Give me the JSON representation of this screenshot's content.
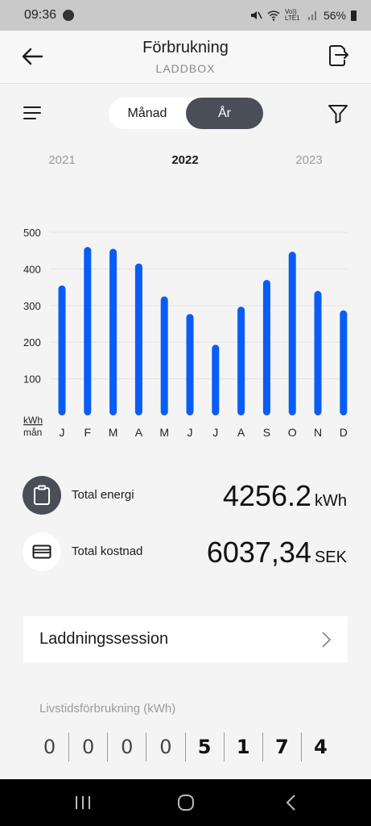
{
  "status_bar": {
    "time": "09:36",
    "battery": "56%",
    "network": "Vo)) LTE1"
  },
  "header": {
    "title": "Förbrukning",
    "subtitle": "LADDBOX"
  },
  "period_toggle": {
    "options": [
      "Månad",
      "År"
    ],
    "selected": "År"
  },
  "years": {
    "previous": "2021",
    "current": "2022",
    "next": "2023"
  },
  "chart_data": {
    "type": "bar",
    "categories": [
      "J",
      "F",
      "M",
      "A",
      "M",
      "J",
      "J",
      "A",
      "S",
      "O",
      "N",
      "D"
    ],
    "values": [
      355,
      460,
      455,
      415,
      325,
      277,
      193,
      297,
      370,
      447,
      340,
      287
    ],
    "yticks": [
      100,
      200,
      300,
      400,
      500
    ],
    "ylim": [
      0,
      500
    ],
    "ylabel": "kWh",
    "xlabel": "mån",
    "grid": true,
    "bar_color": "#0a5cf7"
  },
  "stats": {
    "energy": {
      "label": "Total energi",
      "value": "4256.2",
      "unit": "kWh"
    },
    "cost": {
      "label": "Total kostnad",
      "value": "6037,34",
      "unit": "SEK"
    }
  },
  "session_link": {
    "label": "Laddningssession"
  },
  "lifetime": {
    "label": "Livstidsförbrukning (kWh)",
    "digits": [
      "0",
      "0",
      "0",
      "0",
      "5",
      "1",
      "7",
      "4"
    ]
  },
  "colors": {
    "accent": "#0a5cf7",
    "toggle_active": "#4a4f57",
    "icon_circle": "#4a4f57"
  }
}
